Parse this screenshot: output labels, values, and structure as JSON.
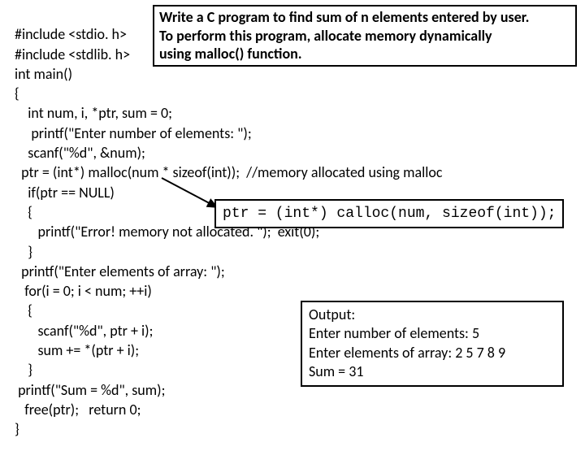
{
  "code": {
    "l1": "#include <stdio. h>",
    "l2": "#include <stdlib. h>",
    "l3": "int main()",
    "l4": "{",
    "l5": "    int num, i, *ptr, sum = 0;",
    "l6": "     printf(\"Enter number of elements: \");",
    "l7": "    scanf(\"%d\", &num);",
    "l8": "  ptr = (int*) malloc(num * sizeof(int));  //memory allocated using malloc",
    "l9": "    if(ptr == NULL)",
    "l10": "    {",
    "l11": "       printf(\"Error! memory not allocated. \");  exit(0);",
    "l12": "    }",
    "l13": "  printf(\"Enter elements of array: \");",
    "l14": "   for(i = 0; i < num; ++i)",
    "l15": "    {",
    "l16": "       scanf(\"%d\", ptr + i);",
    "l17": "       sum += *(ptr + i);",
    "l18": "    }",
    "l19": " printf(\"Sum = %d\", sum);",
    "l20": "   free(ptr);   return 0;",
    "l21": "}"
  },
  "prompt": {
    "line1": "Write a C program to find sum of n elements entered by user.",
    "line2": "To perform this program, allocate memory dynamically",
    "line3": "using malloc() function."
  },
  "calloc": "ptr = (int*) calloc(num, sizeof(int));",
  "output": {
    "title": "Output:",
    "line1": "Enter number of elements: 5",
    "line2": " Enter elements of array: 2 5 7 8 9",
    "line3": " Sum = 31"
  }
}
